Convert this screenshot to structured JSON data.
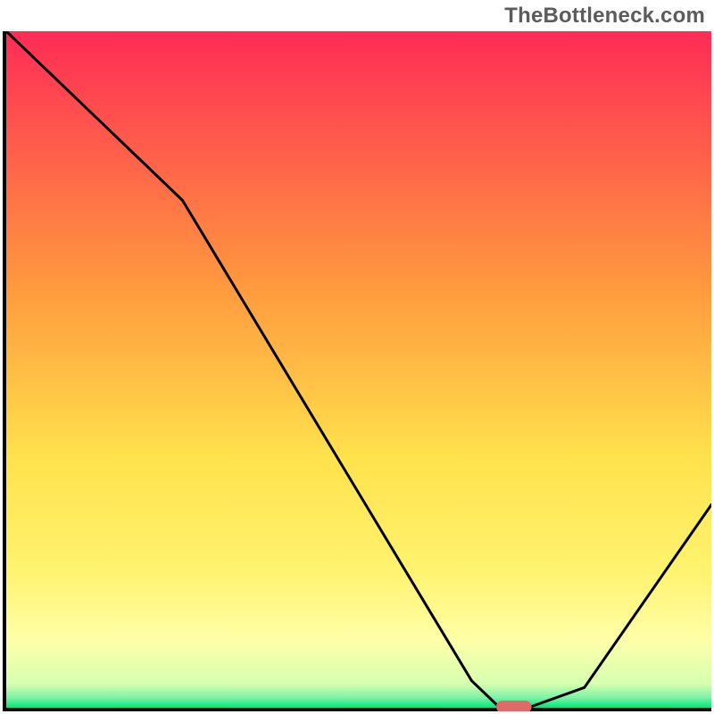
{
  "watermark": "TheBottleneck.com",
  "colors": {
    "gradient_top": "#ff2b56",
    "gradient_mid1": "#ff9a3e",
    "gradient_mid2": "#ffe24c",
    "gradient_yellow": "#fff370",
    "gradient_paleyellow": "#ffffa8",
    "gradient_base": "#00e77a",
    "axis": "#000000",
    "curve": "#000000",
    "marker_fill": "#e06a6a",
    "marker_stroke": "#c74d4d"
  },
  "chart_data": {
    "type": "line",
    "title": "",
    "xlabel": "",
    "ylabel": "",
    "xlim": [
      0,
      100
    ],
    "ylim": [
      0,
      100
    ],
    "x": [
      0,
      25,
      66,
      70,
      74,
      82,
      100
    ],
    "values": [
      100,
      75,
      4,
      0,
      0,
      3,
      30
    ],
    "annotations": [],
    "marker": {
      "x_start": 70,
      "x_end": 74,
      "y": 0
    }
  }
}
